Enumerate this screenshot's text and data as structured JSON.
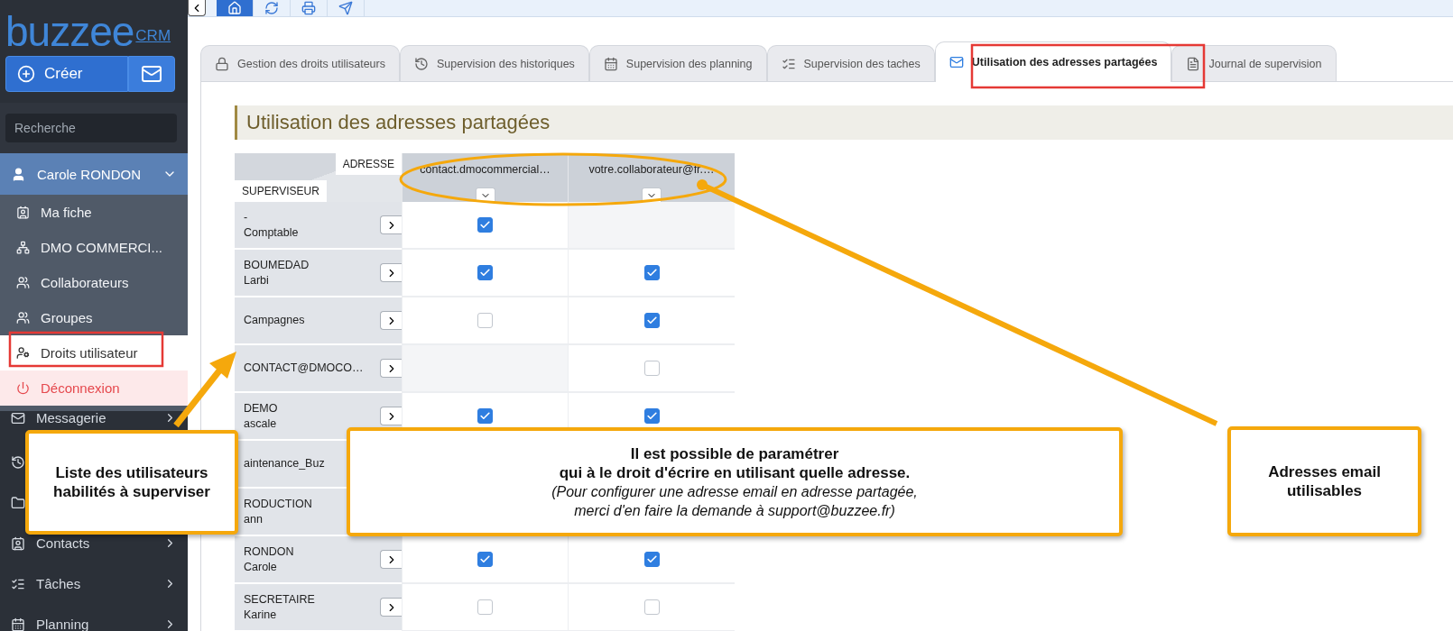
{
  "logo": {
    "word": "buzzee",
    "suffix": "CRM"
  },
  "sidebar": {
    "create_button": "Créer",
    "search": {
      "placeholder": "Recherche"
    },
    "user": {
      "name": "Carole RONDON",
      "expanded": true
    },
    "user_menu": [
      {
        "label": "Ma fiche",
        "selected": false,
        "kind": "link"
      },
      {
        "label": "DMO COMMERCI...",
        "selected": false,
        "kind": "link"
      },
      {
        "label": "Collaborateurs",
        "selected": false,
        "kind": "link"
      },
      {
        "label": "Groupes",
        "selected": false,
        "kind": "link"
      },
      {
        "label": "Droits utilisateur",
        "selected": true,
        "kind": "link"
      },
      {
        "label": "Déconnexion",
        "selected": false,
        "kind": "logout"
      }
    ],
    "nav": [
      {
        "kind": "link",
        "label": "Messagerie"
      },
      {
        "kind": "icon-only"
      },
      {
        "kind": "icon-only"
      },
      {
        "kind": "link",
        "label": "Contacts"
      },
      {
        "kind": "link",
        "label": "Tâches"
      },
      {
        "kind": "link",
        "label": "Planning"
      }
    ]
  },
  "toolbar": [
    {
      "selected": true
    },
    {
      "selected": false
    },
    {
      "selected": false
    },
    {
      "selected": false
    }
  ],
  "tabs": [
    {
      "label": "Gestion des droits utilisateurs",
      "selected": false
    },
    {
      "label": "Supervision des historiques",
      "selected": false
    },
    {
      "label": "Supervision des planning",
      "selected": false
    },
    {
      "label": "Supervision des taches",
      "selected": false
    },
    {
      "label": "Utilisation des adresses partagées",
      "selected": true
    },
    {
      "label": "Journal de supervision",
      "selected": false
    }
  ],
  "section_title": "Utilisation des adresses partagées",
  "table": {
    "corner": {
      "column_label": "ADRESSE",
      "row_label": "SUPERVISEUR"
    },
    "columns": [
      "contact.dmocommercial…",
      "votre.collaborateur@fr.…"
    ],
    "rows": [
      {
        "lines": [
          "-",
          "Comptable"
        ],
        "open_button": true,
        "cells": [
          {
            "kind": "checkbox",
            "checked": true
          },
          {
            "kind": "empty"
          }
        ]
      },
      {
        "lines": [
          "BOUMEDAD",
          "Larbi"
        ],
        "open_button": true,
        "cells": [
          {
            "kind": "checkbox",
            "checked": true
          },
          {
            "kind": "checkbox",
            "checked": true
          }
        ]
      },
      {
        "lines": [
          "Campagnes"
        ],
        "open_button": true,
        "cells": [
          {
            "kind": "checkbox",
            "checked": false
          },
          {
            "kind": "checkbox",
            "checked": true
          }
        ]
      },
      {
        "lines": [
          "CONTACT@DMOCO…"
        ],
        "open_button": true,
        "cells": [
          {
            "kind": "empty"
          },
          {
            "kind": "checkbox",
            "checked": false
          }
        ]
      },
      {
        "lines": [
          "DEMO",
          "ascale"
        ],
        "open_button": true,
        "cells": [
          {
            "kind": "checkbox",
            "checked": true
          },
          {
            "kind": "checkbox",
            "checked": true
          }
        ]
      },
      {
        "lines": [
          "aintenance_Buz"
        ],
        "open_button": false
      },
      {
        "lines": [
          "RODUCTION",
          "ann"
        ],
        "open_button": false
      },
      {
        "lines": [
          "RONDON",
          "Carole"
        ],
        "open_button": true,
        "cells": [
          {
            "kind": "checkbox",
            "checked": true
          },
          {
            "kind": "checkbox",
            "checked": true
          }
        ]
      },
      {
        "lines": [
          "SECRETAIRE",
          "Karine"
        ],
        "open_button": true,
        "cells": [
          {
            "kind": "checkbox",
            "checked": false
          },
          {
            "kind": "checkbox",
            "checked": false
          }
        ]
      }
    ]
  },
  "annotations": [
    {
      "kind": "callout",
      "title": "Liste des utilisateurs\nhabilités à superviser"
    },
    {
      "kind": "callout",
      "title": "Il est possible de paramétrer\nqui à le droit d'écrire en utilisant quelle adresse.",
      "note": "(Pour configurer une adresse email en adresse partagée,\nmerci d'en faire la demande à support@buzzee.fr)"
    },
    {
      "kind": "callout",
      "title": "Adresses email\nutilisables"
    }
  ]
}
